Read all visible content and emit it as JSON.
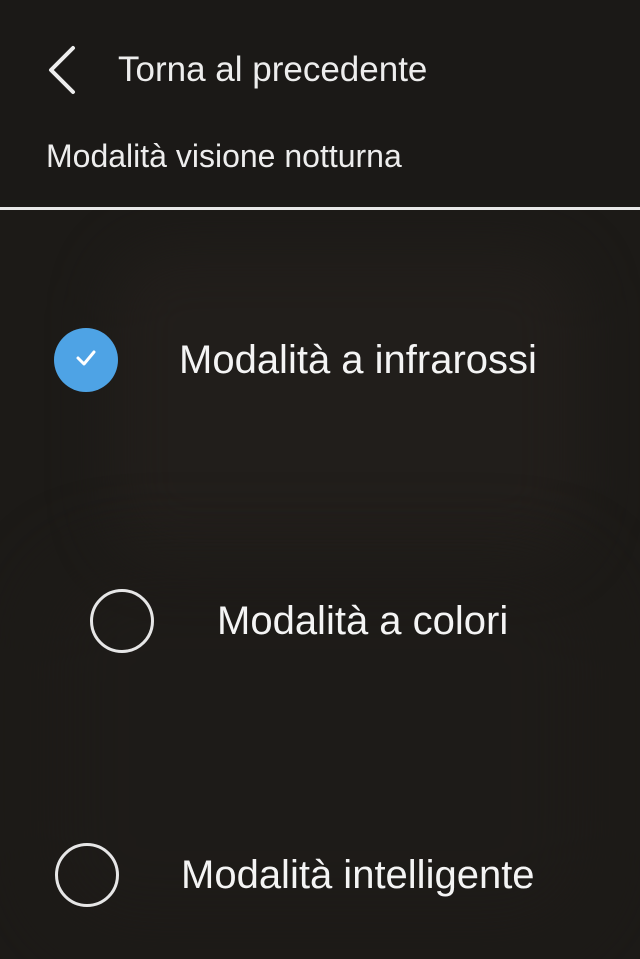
{
  "colors": {
    "background": "#1c1a17",
    "text": "#f2f2f2",
    "accent": "#4ea3e5",
    "divider": "#e8e8e8"
  },
  "header": {
    "back_label": "Torna al precedente",
    "back_icon": "chevron-left-icon",
    "title": "Modalità visione notturna"
  },
  "options": [
    {
      "label": "Modalità a infrarossi",
      "selected": true,
      "icon": "checkmark-icon"
    },
    {
      "label": "Modalità a colori",
      "selected": false
    },
    {
      "label": "Modalità intelligente",
      "selected": false
    }
  ]
}
